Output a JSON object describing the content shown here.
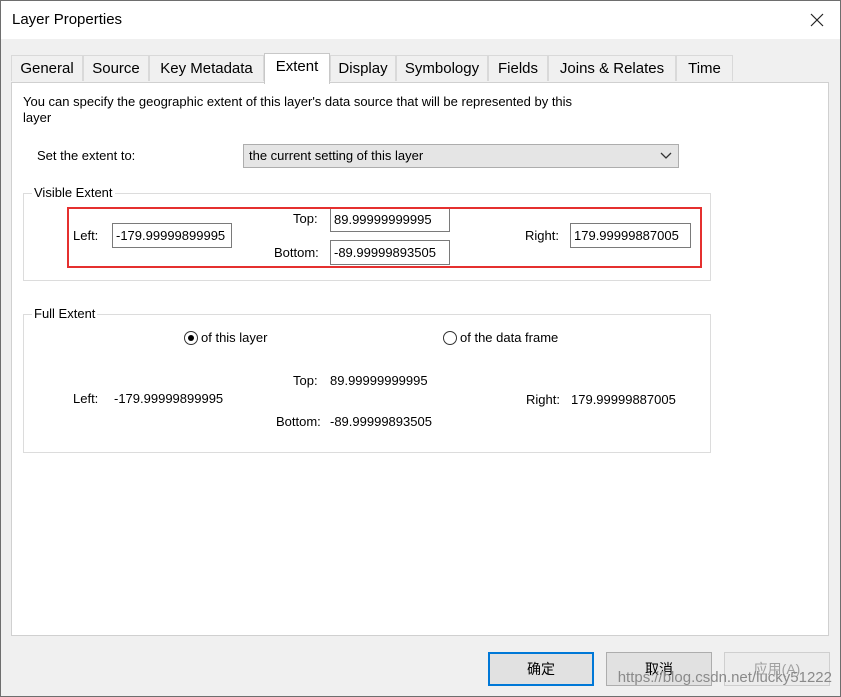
{
  "window": {
    "title": "Layer Properties"
  },
  "tabs": [
    {
      "label": "General"
    },
    {
      "label": "Source"
    },
    {
      "label": "Key Metadata"
    },
    {
      "label": "Extent"
    },
    {
      "label": "Display"
    },
    {
      "label": "Symbology"
    },
    {
      "label": "Fields"
    },
    {
      "label": "Joins & Relates"
    },
    {
      "label": "Time"
    }
  ],
  "active_tab": "Extent",
  "extent": {
    "description": "You can specify the geographic extent of this layer's data source that will be represented by this layer",
    "set_extent_label": "Set the extent to:",
    "set_extent_value": "the current setting of this layer",
    "visible": {
      "legend": "Visible Extent",
      "left_label": "Left:",
      "left_value": "-179.99999899995",
      "top_label": "Top:",
      "top_value": "89.99999999995",
      "bottom_label": "Bottom:",
      "bottom_value": "-89.99999893505",
      "right_label": "Right:",
      "right_value": "179.99999887005"
    },
    "full": {
      "legend": "Full Extent",
      "radio_layer": "of this layer",
      "radio_frame": "of the data frame",
      "selected": "of this layer",
      "left_label": "Left:",
      "left_value": "-179.99999899995",
      "top_label": "Top:",
      "top_value": "89.99999999995",
      "bottom_label": "Bottom:",
      "bottom_value": "-89.99999893505",
      "right_label": "Right:",
      "right_value": "179.99999887005"
    }
  },
  "buttons": {
    "ok": "确定",
    "cancel": "取消",
    "apply": "应用(A)"
  },
  "watermark": "https://blog.csdn.net/lucky51222",
  "colors": {
    "highlight_border": "#e5302f",
    "default_button_border": "#0078d7"
  },
  "icons": {
    "close": "close-icon",
    "dropdown": "chevron-down-icon"
  }
}
